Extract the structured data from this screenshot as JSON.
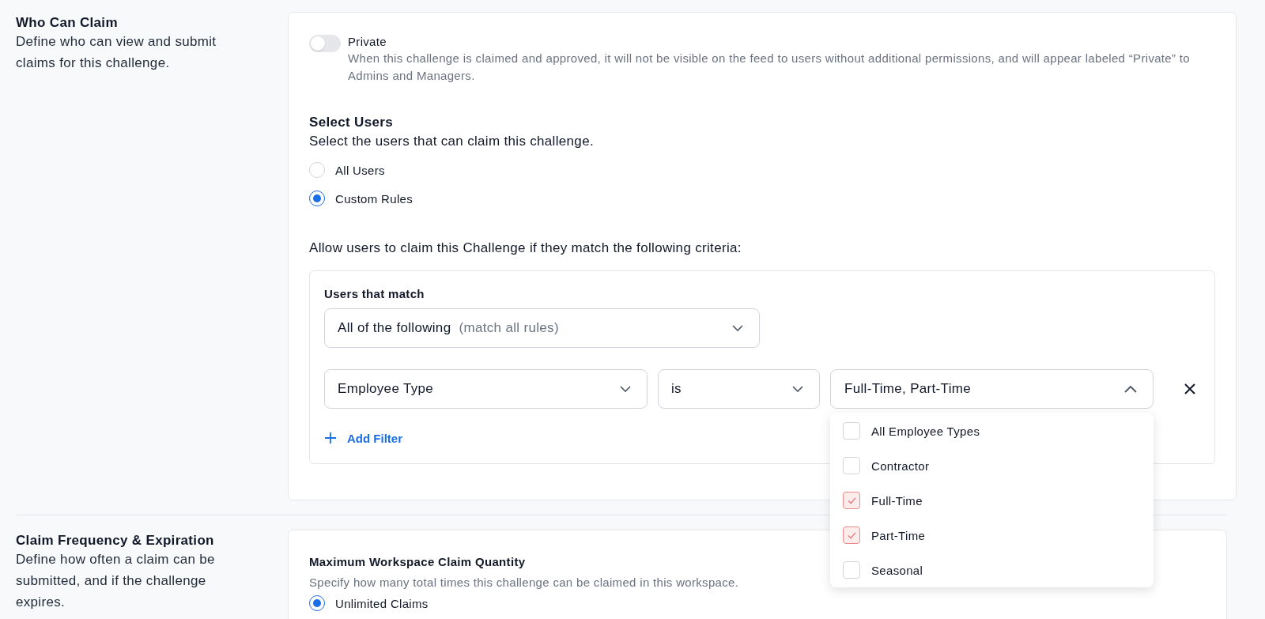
{
  "who_can_claim": {
    "title": "Who Can Claim",
    "description": "Define who can view and submit claims for this challenge.",
    "private_toggle": {
      "label": "Private",
      "on": false,
      "description": "When this challenge is claimed and approved, it will not be visible on the feed to users without additional permissions, and will appear labeled “Private” to Admins and Managers."
    },
    "select_users": {
      "heading": "Select Users",
      "description": "Select the users that can claim this challenge.",
      "options": [
        {
          "label": "All Users",
          "selected": false
        },
        {
          "label": "Custom Rules",
          "selected": true
        }
      ]
    },
    "criteria_intro": "Allow users to claim this Challenge if they match the following criteria:",
    "rule_box": {
      "label": "Users that match",
      "match_select": {
        "value": "All of the following",
        "hint": "(match all rules)"
      },
      "filters": [
        {
          "field": "Employee Type",
          "operator": "is",
          "value": "Full-Time, Part-Time",
          "open": true,
          "options": [
            {
              "label": "All Employee Types",
              "checked": false
            },
            {
              "label": "Contractor",
              "checked": false
            },
            {
              "label": "Full-Time",
              "checked": true
            },
            {
              "label": "Part-Time",
              "checked": true
            },
            {
              "label": "Seasonal",
              "checked": false
            }
          ]
        }
      ],
      "add_filter": "Add Filter"
    }
  },
  "claim_frequency": {
    "title": "Claim Frequency & Expiration",
    "description": "Define how often a claim can be submitted, and if the challenge expires.",
    "max_claims": {
      "heading": "Maximum Workspace Claim Quantity",
      "description": "Specify how many total times this challenge can be claimed in this workspace.",
      "options": [
        {
          "label": "Unlimited Claims",
          "selected": true
        }
      ]
    }
  }
}
